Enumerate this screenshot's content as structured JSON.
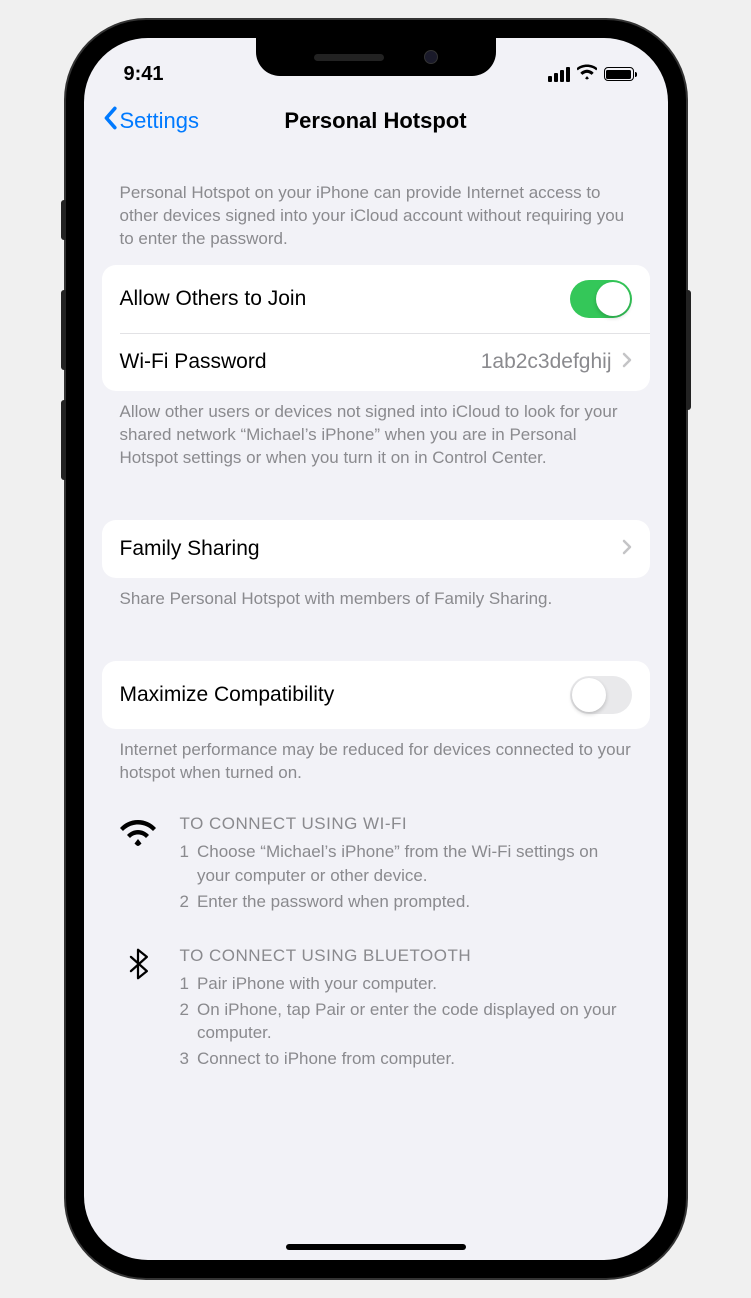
{
  "status": {
    "time": "9:41"
  },
  "nav": {
    "back_label": "Settings",
    "title": "Personal Hotspot"
  },
  "intro_text": "Personal Hotspot on your iPhone can provide Internet access to other devices signed into your iCloud account without requiring you to enter the password.",
  "cells": {
    "allow_others": "Allow Others to Join",
    "wifi_password_label": "Wi-Fi Password",
    "wifi_password_value": "1ab2c3defghij",
    "family_sharing": "Family Sharing",
    "maximize_compat": "Maximize Compatibility"
  },
  "footers": {
    "allow_others": "Allow other users or devices not signed into iCloud to look for your shared network “Michael’s iPhone” when you are in Personal Hotspot settings or when you turn it on in Control Center.",
    "family_sharing": "Share Personal Hotspot with members of Family Sharing.",
    "maximize_compat": "Internet performance may be reduced for devices connected to your hotspot when turned on."
  },
  "instructions": {
    "wifi": {
      "title": "TO CONNECT USING WI-FI",
      "steps": [
        "Choose “Michael’s iPhone” from the Wi-Fi settings on your computer or other device.",
        "Enter the password when prompted."
      ]
    },
    "bluetooth": {
      "title": "TO CONNECT USING BLUETOOTH",
      "steps": [
        "Pair iPhone with your computer.",
        "On iPhone, tap Pair or enter the code displayed on your computer.",
        "Connect to iPhone from computer."
      ]
    }
  }
}
